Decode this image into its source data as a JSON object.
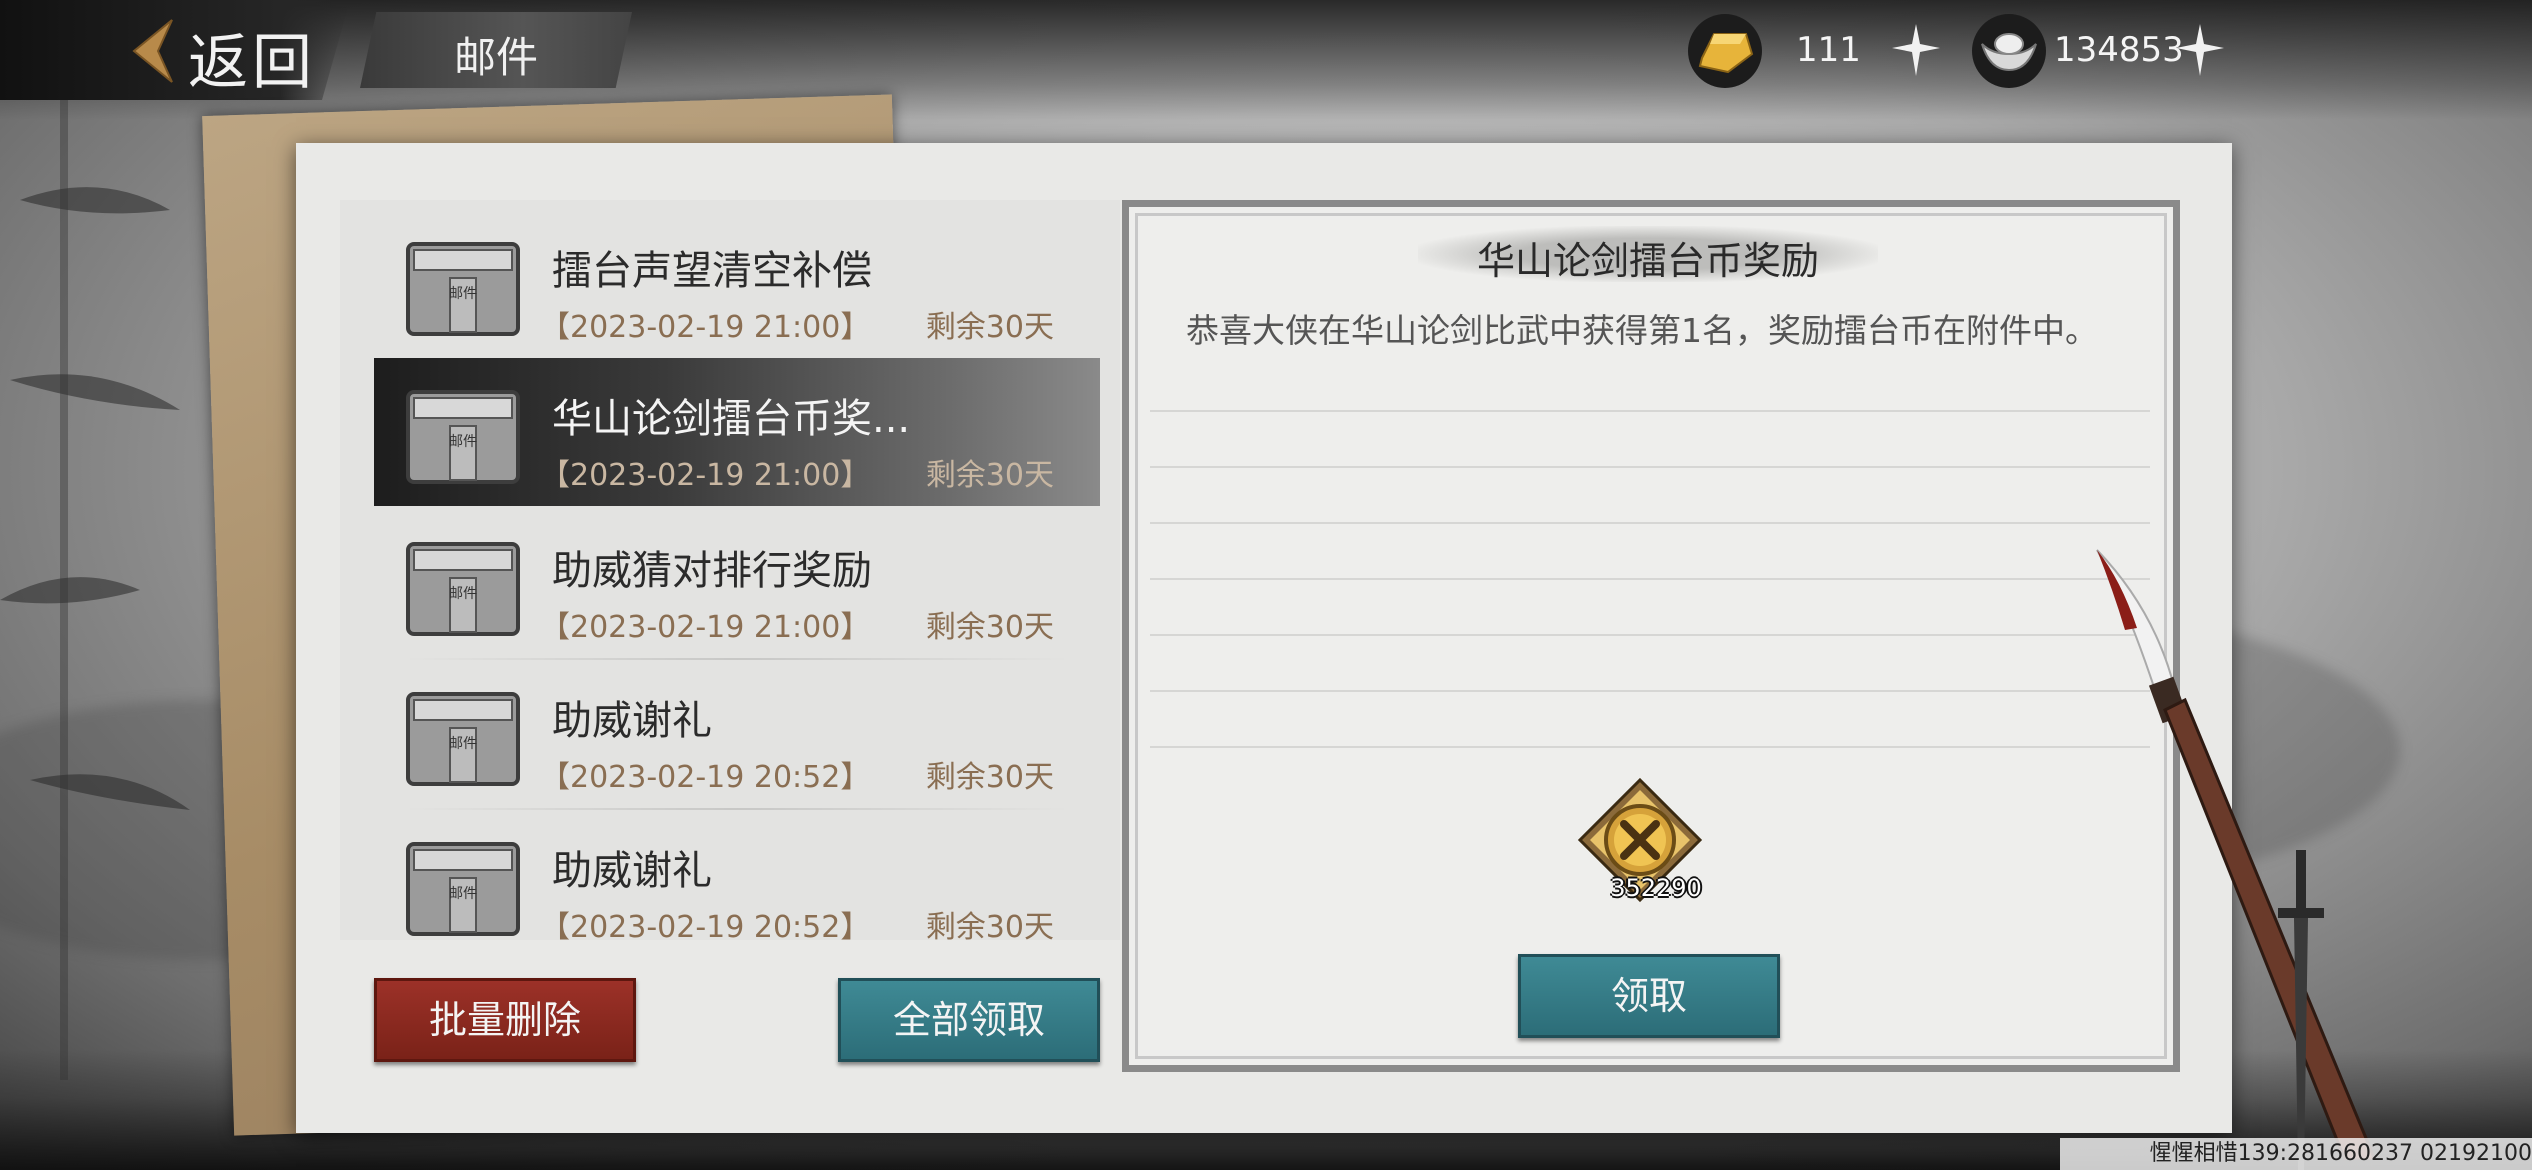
{
  "header": {
    "back_label": "返回",
    "title": "邮件",
    "gold": {
      "icon": "gold-ingot-icon",
      "value": "111"
    },
    "silver": {
      "icon": "silver-ingot-icon",
      "value": "134853"
    }
  },
  "mail_list": [
    {
      "title": "擂台声望清空补偿",
      "date": "【2023-02-19 21:00】",
      "remaining": "剩余30天",
      "selected": false
    },
    {
      "title": "华山论剑擂台币奖...",
      "date": "【2023-02-19 21:00】",
      "remaining": "剩余30天",
      "selected": true
    },
    {
      "title": "助威猜对排行奖励",
      "date": "【2023-02-19 21:00】",
      "remaining": "剩余30天",
      "selected": false
    },
    {
      "title": "助威谢礼",
      "date": "【2023-02-19 20:52】",
      "remaining": "剩余30天",
      "selected": false
    },
    {
      "title": "助威谢礼",
      "date": "【2023-02-19 20:52】",
      "remaining": "剩余30天",
      "selected": false
    }
  ],
  "envelope_label": "邮件",
  "buttons": {
    "batch_delete": "批量删除",
    "claim_all": "全部领取",
    "claim": "领取"
  },
  "detail": {
    "title": "华山论剑擂台币奖励",
    "body": "恭喜大侠在华山论剑比武中获得第1名，奖励擂台币在附件中。",
    "attachment": {
      "icon": "arena-coin-icon",
      "count": "352290"
    }
  },
  "watermark": "惺惺相惜139:281660237 02192100",
  "colors": {
    "delete_button": "#9c3128",
    "claim_button": "#3f8a95",
    "date_text": "#8a6e52"
  }
}
